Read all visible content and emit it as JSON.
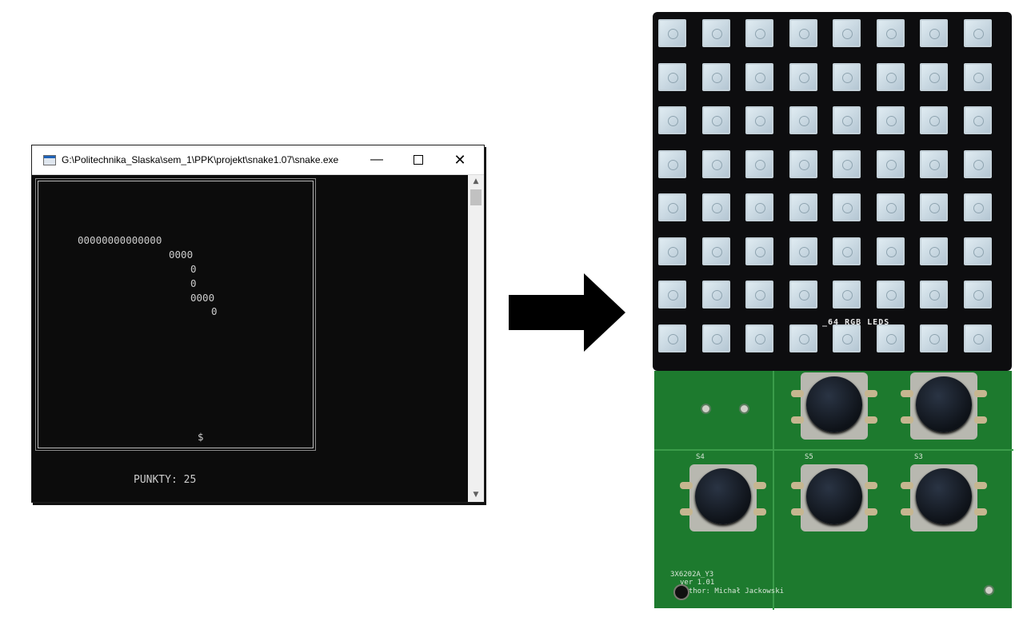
{
  "window": {
    "title": "G:\\Politechnika_Slaska\\sem_1\\PPK\\projekt\\snake1.07\\snake.exe",
    "minimize_label": "—",
    "close_label": "✕"
  },
  "game": {
    "snake_lines": [
      "00000000000000",
      "0000",
      "0",
      "0",
      "0000",
      "0"
    ],
    "food": "$",
    "score_text": "PUNKTY: 25"
  },
  "board_photo": {
    "led_label": "_64 RGB LEDS",
    "button_labels": [
      "S4",
      "S5",
      "S3"
    ],
    "silk_code": "3X6202A_Y3",
    "silk_version": "ver 1.01",
    "silk_author": "author: Michał Jackowski"
  },
  "colors": {
    "console_bg": "#0c0c0c",
    "console_text": "#cccccc",
    "pcb_green": "#1d7a2e",
    "led_panel": "#0d0d0f"
  }
}
